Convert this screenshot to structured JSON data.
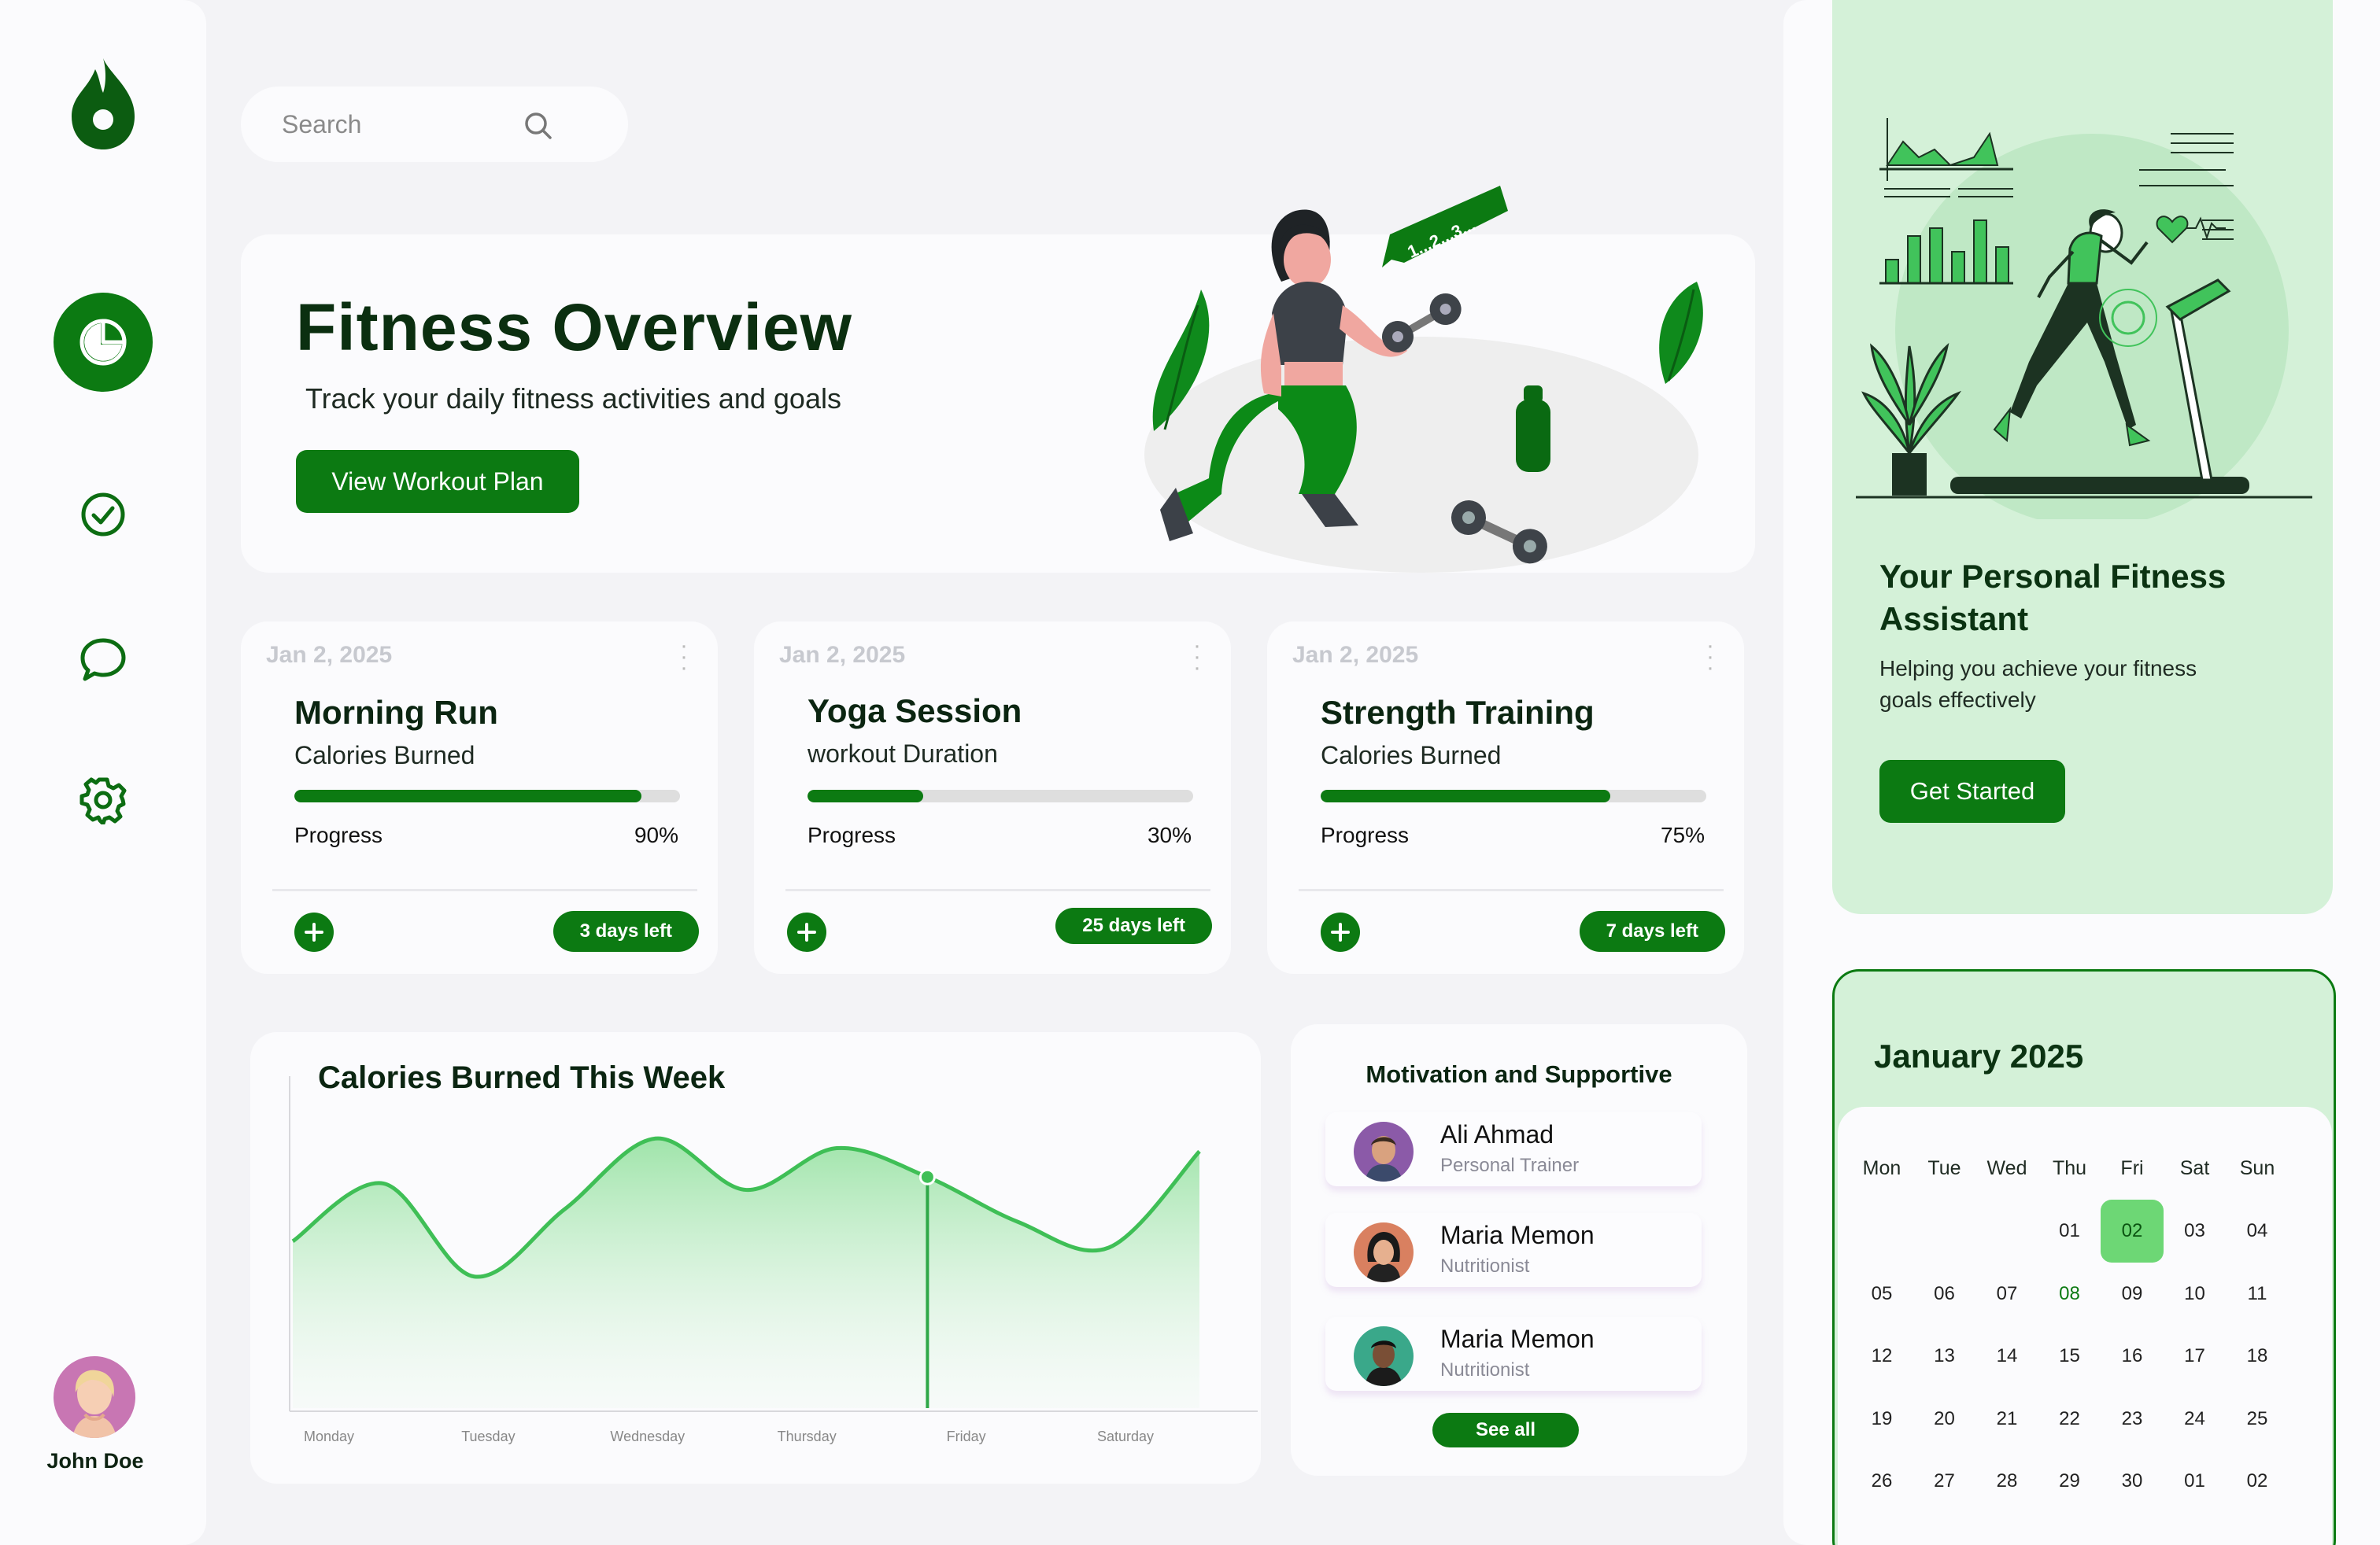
{
  "user": {
    "name": "John Doe"
  },
  "search": {
    "placeholder": "Search"
  },
  "hero": {
    "title": "Fitness Overview",
    "subtitle": "Track your daily fitness activities and goals",
    "button": "View Workout Plan",
    "illustration_caption": "1...2...3..."
  },
  "activities": [
    {
      "date": "Jan 2, 2025",
      "name": "Morning Run",
      "metric": "Calories Burned",
      "progress_label": "Progress",
      "progress": 90,
      "progress_text": "90%",
      "days_left": "3 days left"
    },
    {
      "date": "Jan 2, 2025",
      "name": "Yoga Session",
      "metric": "workout Duration",
      "progress_label": "Progress",
      "progress": 30,
      "progress_text": "30%",
      "days_left": "25 days left"
    },
    {
      "date": "Jan 2, 2025",
      "name": "Strength Training",
      "metric": "Calories Burned",
      "progress_label": "Progress",
      "progress": 75,
      "progress_text": "75%",
      "days_left": "7 days left"
    }
  ],
  "calories_chart": {
    "title": "Calories Burned This Week",
    "days": [
      "Monday",
      "Tuesday",
      "Wednesday",
      "Thursday",
      "Friday",
      "Saturday"
    ]
  },
  "chart_data": {
    "type": "area",
    "title": "Calories Burned This Week",
    "x": [
      "Monday",
      "Tuesday",
      "Wednesday",
      "Thursday",
      "Friday",
      "Saturday"
    ],
    "grid": false,
    "highlight_index": 7,
    "series": [
      {
        "values": [
          52,
          70,
          41,
          62,
          84,
          68,
          81,
          72,
          58,
          50,
          80
        ]
      }
    ],
    "ylim": [
      0,
      100
    ]
  },
  "motivation": {
    "title": "Motivation and Supportive",
    "people": [
      {
        "name": "Ali Ahmad",
        "role": "Personal Trainer"
      },
      {
        "name": "Maria Memon",
        "role": "Nutritionist"
      },
      {
        "name": "Maria Memon",
        "role": "Nutritionist"
      }
    ],
    "see_all": "See all"
  },
  "assistant": {
    "title": "Your Personal Fitness Assistant",
    "subtitle": "Helping you achieve your fitness goals effectively",
    "button": "Get Started"
  },
  "calendar": {
    "title": "January 2025",
    "weekdays": [
      "Mon",
      "Tue",
      "Wed",
      "Thu",
      "Fri",
      "Sat",
      "Sun"
    ],
    "selected": "02",
    "weeks": [
      [
        "",
        "",
        "",
        "01",
        "02",
        "03",
        "04"
      ],
      [
        "05",
        "06",
        "07",
        "08",
        "09",
        "10",
        "11"
      ],
      [
        "12",
        "13",
        "14",
        "15",
        "16",
        "17",
        "18"
      ],
      [
        "19",
        "20",
        "21",
        "22",
        "23",
        "24",
        "25"
      ],
      [
        "26",
        "27",
        "28",
        "29",
        "30",
        "01",
        "02"
      ]
    ],
    "marked": [
      "08"
    ]
  },
  "colors": {
    "brand": "#0c7a12",
    "accent_light": "#d4f1d8",
    "chart_line": "#3fbf56",
    "selected_day": "#6dd775"
  },
  "icons": [
    "flame-icon",
    "pie-chart-icon",
    "check-circle-icon",
    "chat-icon",
    "gear-icon",
    "search-icon",
    "plus-icon",
    "more-icon"
  ]
}
